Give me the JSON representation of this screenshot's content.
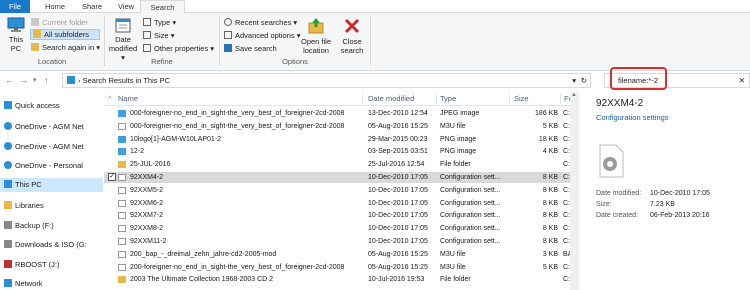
{
  "tabs": {
    "file": "File",
    "home": "Home",
    "share": "Share",
    "view": "View",
    "search": "Search"
  },
  "ribbon": {
    "this_pc": "This PC",
    "current_folder": "Current folder",
    "all_subfolders": "All subfolders",
    "search_again_in": "Search again in",
    "location_label": "Location",
    "date_modified": "Date modified",
    "kind": "Type",
    "size": "Size",
    "other_properties": "Other properties",
    "refine_label": "Refine",
    "recent_searches": "Recent searches",
    "advanced_options": "Advanced options",
    "save_search": "Save search",
    "open_file_location": "Open file location",
    "close_search": "Close search",
    "options_label": "Options"
  },
  "address": {
    "path": "Search Results in This PC",
    "search_value": "filename:*-2"
  },
  "nav": {
    "items": [
      "Quick access",
      "OneDrive - AGM Net",
      "OneDrive - AGM Net",
      "OneDrive - Personal",
      "This PC",
      "Libraries",
      "Backup (F:)",
      "Downloads & ISO (G:",
      "RBOOST (J:)",
      "Network"
    ]
  },
  "columns": {
    "name": "Name",
    "date": "Date modified",
    "type": "Type",
    "size": "Size",
    "folder": "Fo"
  },
  "files": [
    {
      "name": "000-foreigner-no_end_in_sight-the_very_best_of_foreigner-2cd-2008",
      "date": "13-Dec-2010 12:54",
      "type": "JPEG image",
      "size": "186 KB",
      "kind": "img"
    },
    {
      "name": "000-foreigner-no_end_in_sight-the_very_best_of_foreigner-2cd-2008",
      "date": "05-Aug-2016 15:25",
      "type": "M3U file",
      "size": "5 KB",
      "kind": "doc"
    },
    {
      "name": "10logo[1]-AGM-W10LAP01-2",
      "date": "29-Mar-2015 00:23",
      "type": "PNG image",
      "size": "18 KB",
      "kind": "img"
    },
    {
      "name": "12-2",
      "date": "03-Sep-2015 03:51",
      "type": "PNG image",
      "size": "4 KB",
      "kind": "img"
    },
    {
      "name": "25-JUL-2016",
      "date": "25-Jul-2016 12:54",
      "type": "File folder",
      "size": "",
      "kind": "folder"
    },
    {
      "name": "92XXM4-2",
      "date": "10-Dec-2010 17:05",
      "type": "Configuration sett...",
      "size": "8 KB",
      "kind": "cfg"
    },
    {
      "name": "92XXM5-2",
      "date": "10-Dec-2010 17:05",
      "type": "Configuration sett...",
      "size": "8 KB",
      "kind": "cfg"
    },
    {
      "name": "92XXM6-2",
      "date": "10-Dec-2010 17:05",
      "type": "Configuration sett...",
      "size": "8 KB",
      "kind": "cfg"
    },
    {
      "name": "92XXM7-2",
      "date": "10-Dec-2010 17:05",
      "type": "Configuration sett...",
      "size": "8 KB",
      "kind": "cfg"
    },
    {
      "name": "92XXM8-2",
      "date": "10-Dec-2010 17:05",
      "type": "Configuration sett...",
      "size": "8 KB",
      "kind": "cfg"
    },
    {
      "name": "92XXM11-2",
      "date": "10-Dec-2010 17:05",
      "type": "Configuration sett...",
      "size": "8 KB",
      "kind": "cfg"
    },
    {
      "name": "200_bap_-_dreimal_zehn_jahre-cd2-2005-mod",
      "date": "05-Aug-2016 15:25",
      "type": "M3U file",
      "size": "3 KB",
      "kind": "doc"
    },
    {
      "name": "200-foreigner-no_end_in_sight-the_very_best_of_foreigner-2cd-2008",
      "date": "05-Aug-2016 15:25",
      "type": "M3U file",
      "size": "5 KB",
      "kind": "doc"
    },
    {
      "name": "2003 The Ultimate Collection 1968-2003 CD 2",
      "date": "10-Jul-2016 19:53",
      "type": "File folder",
      "size": "",
      "kind": "folder"
    }
  ],
  "folder_col": [
    "C:",
    "C:",
    "C:",
    "C:",
    "C:",
    "C:",
    "C:",
    "C:",
    "C:",
    "C:",
    "C:",
    "BA",
    "C:",
    "C:"
  ],
  "details": {
    "name": "92XXM4-2",
    "type": "Configuration settings",
    "date_modified_label": "Date modified:",
    "date_modified": "10-Dec-2010 17:05",
    "size_label": "Size:",
    "size": "7.23 KB",
    "date_created_label": "Date created:",
    "date_created": "06-Feb-2013 20:16"
  },
  "colors": {
    "accent": "#1979ca",
    "highlight": "#d82e2e",
    "selected_row": "#d9d9d9",
    "nav_selected": "#cce8ff"
  }
}
